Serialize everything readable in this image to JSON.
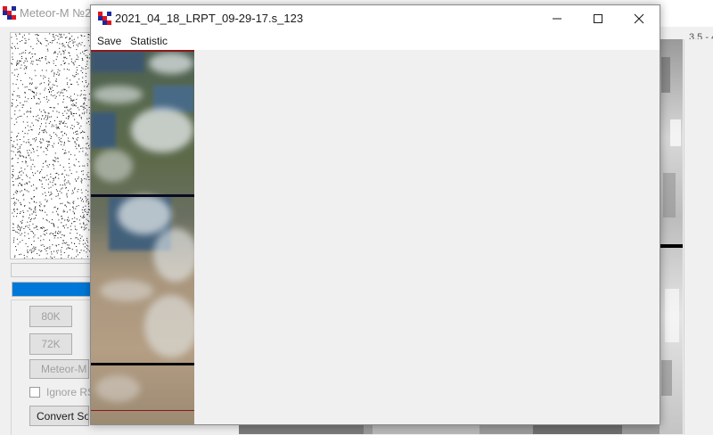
{
  "background_app": {
    "title": "Meteor-M №2",
    "right_label": "3.5 - 4",
    "progress_fraction": 1.0,
    "buttons": {
      "b80k": "80K",
      "b72k": "72K",
      "meteor": "Meteor-M N",
      "convert": "Convert Soft"
    },
    "ignore_rs_label": "Ignore RS"
  },
  "image_window": {
    "title": "2021_04_18_LRPT_09-29-17.s_123",
    "menu": {
      "save": "Save",
      "statistic": "Statistic"
    },
    "controls": [
      "minimize-icon",
      "maximize-icon",
      "close-icon"
    ]
  },
  "colors": {
    "progress": "#0078d7",
    "logo_red": "#e0141e",
    "logo_blue": "#1a2a9c"
  }
}
